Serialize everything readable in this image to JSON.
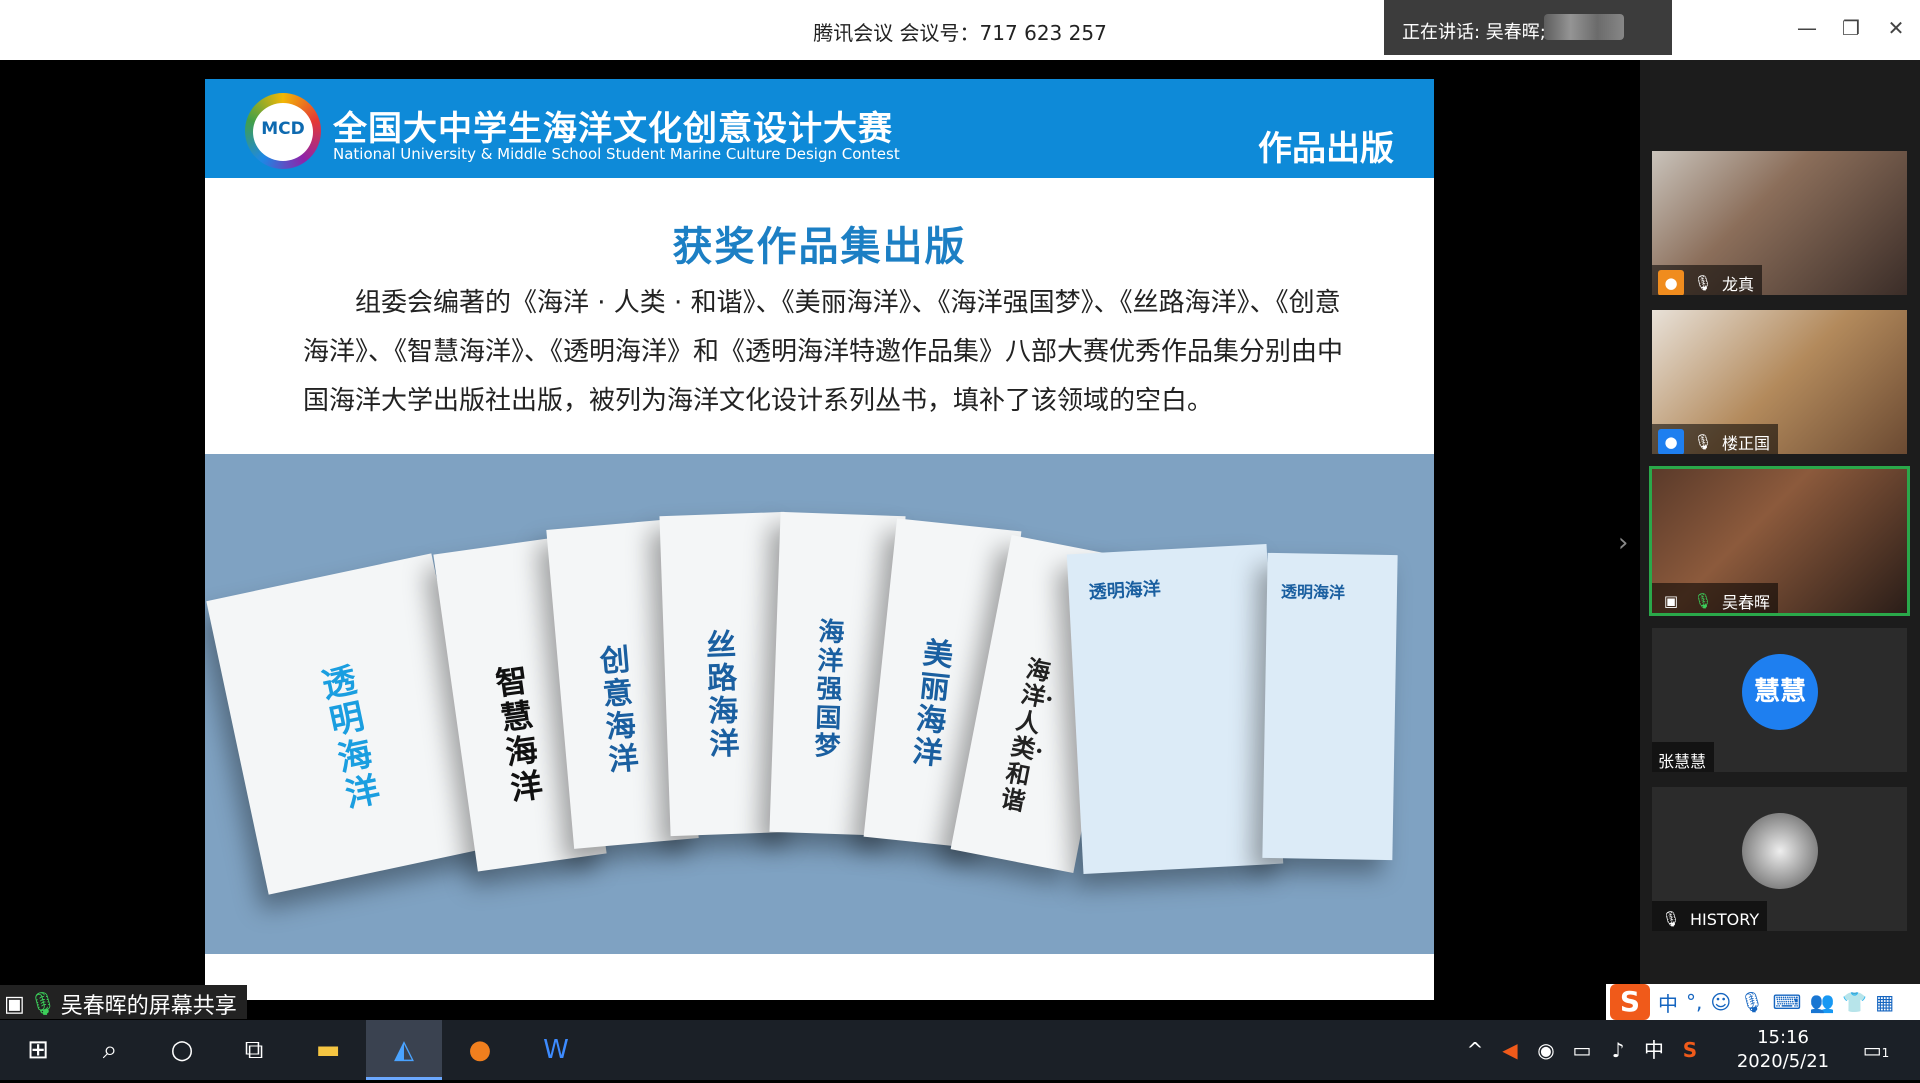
{
  "window": {
    "meeting_title": "腾讯会议 会议号：717 623 257",
    "speaking_label": "正在讲话: 吴春晖;",
    "minimize": "—",
    "restore": "❐",
    "close": "✕"
  },
  "slide": {
    "logo_text": "MCD",
    "banner_cn": "全国大中学生海洋文化创意设计大赛",
    "banner_en": "National University & Middle School Student Marine Culture Design Contest",
    "banner_right": "作品出版",
    "title": "获奖作品集出版",
    "body": "组委会编著的《海洋 · 人类 · 和谐》、《美丽海洋》、《海洋强国梦》、《丝路海洋》、《创意海洋》、《智慧海洋》、《透明海洋》和《透明海洋特邀作品集》八部大赛优秀作品集分别由中国海洋大学出版社出版，被列为海洋文化设计系列丛书，填补了该领域的空白。",
    "books": [
      "透明海洋",
      "智慧海洋",
      "创意海洋",
      "丝路海洋",
      "海洋强国梦",
      "美丽海洋",
      "海洋·人类·和谐",
      "透明海洋",
      "透明海洋"
    ]
  },
  "participants": [
    {
      "name": "龙真"
    },
    {
      "name": "楼正国"
    },
    {
      "name": "吴春晖"
    },
    {
      "name": "张慧慧",
      "avatar_text": "慧慧"
    },
    {
      "name": "HISTORY"
    }
  ],
  "share_label": "吴春晖的屏幕共享",
  "ime": {
    "lang": "中",
    "punct": "°,"
  },
  "taskbar": {
    "tray_lang": "中",
    "time": "15:16",
    "date": "2020/5/21",
    "notif_count": "1"
  },
  "colors": {
    "banner": "#0e8ad8",
    "title": "#1c7fc4",
    "active_border": "#2aa84a",
    "avatar": "#1e7ff0"
  }
}
